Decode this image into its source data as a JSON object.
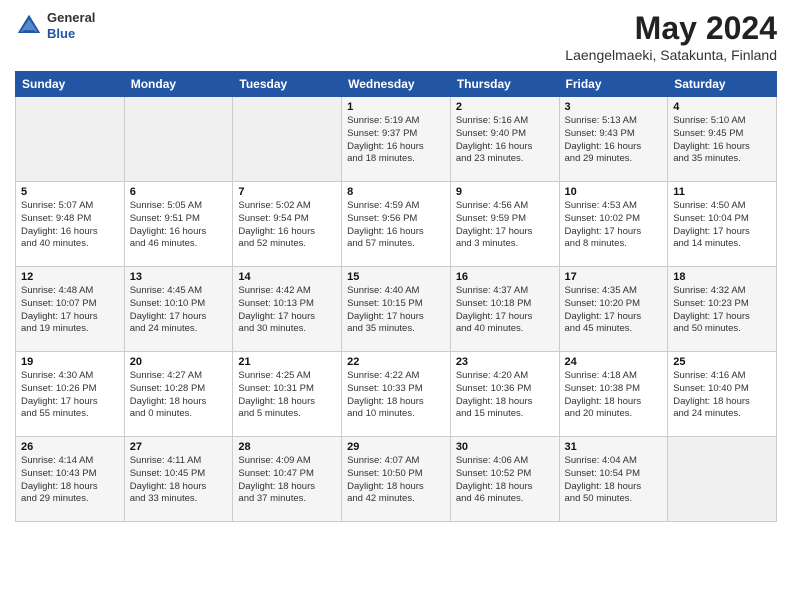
{
  "header": {
    "logo": {
      "general": "General",
      "blue": "Blue"
    },
    "title": "May 2024",
    "location": "Laengelmaeki, Satakunta, Finland"
  },
  "weekdays": [
    "Sunday",
    "Monday",
    "Tuesday",
    "Wednesday",
    "Thursday",
    "Friday",
    "Saturday"
  ],
  "weeks": [
    [
      {
        "day": "",
        "info": ""
      },
      {
        "day": "",
        "info": ""
      },
      {
        "day": "",
        "info": ""
      },
      {
        "day": "1",
        "info": "Sunrise: 5:19 AM\nSunset: 9:37 PM\nDaylight: 16 hours\nand 18 minutes."
      },
      {
        "day": "2",
        "info": "Sunrise: 5:16 AM\nSunset: 9:40 PM\nDaylight: 16 hours\nand 23 minutes."
      },
      {
        "day": "3",
        "info": "Sunrise: 5:13 AM\nSunset: 9:43 PM\nDaylight: 16 hours\nand 29 minutes."
      },
      {
        "day": "4",
        "info": "Sunrise: 5:10 AM\nSunset: 9:45 PM\nDaylight: 16 hours\nand 35 minutes."
      }
    ],
    [
      {
        "day": "5",
        "info": "Sunrise: 5:07 AM\nSunset: 9:48 PM\nDaylight: 16 hours\nand 40 minutes."
      },
      {
        "day": "6",
        "info": "Sunrise: 5:05 AM\nSunset: 9:51 PM\nDaylight: 16 hours\nand 46 minutes."
      },
      {
        "day": "7",
        "info": "Sunrise: 5:02 AM\nSunset: 9:54 PM\nDaylight: 16 hours\nand 52 minutes."
      },
      {
        "day": "8",
        "info": "Sunrise: 4:59 AM\nSunset: 9:56 PM\nDaylight: 16 hours\nand 57 minutes."
      },
      {
        "day": "9",
        "info": "Sunrise: 4:56 AM\nSunset: 9:59 PM\nDaylight: 17 hours\nand 3 minutes."
      },
      {
        "day": "10",
        "info": "Sunrise: 4:53 AM\nSunset: 10:02 PM\nDaylight: 17 hours\nand 8 minutes."
      },
      {
        "day": "11",
        "info": "Sunrise: 4:50 AM\nSunset: 10:04 PM\nDaylight: 17 hours\nand 14 minutes."
      }
    ],
    [
      {
        "day": "12",
        "info": "Sunrise: 4:48 AM\nSunset: 10:07 PM\nDaylight: 17 hours\nand 19 minutes."
      },
      {
        "day": "13",
        "info": "Sunrise: 4:45 AM\nSunset: 10:10 PM\nDaylight: 17 hours\nand 24 minutes."
      },
      {
        "day": "14",
        "info": "Sunrise: 4:42 AM\nSunset: 10:13 PM\nDaylight: 17 hours\nand 30 minutes."
      },
      {
        "day": "15",
        "info": "Sunrise: 4:40 AM\nSunset: 10:15 PM\nDaylight: 17 hours\nand 35 minutes."
      },
      {
        "day": "16",
        "info": "Sunrise: 4:37 AM\nSunset: 10:18 PM\nDaylight: 17 hours\nand 40 minutes."
      },
      {
        "day": "17",
        "info": "Sunrise: 4:35 AM\nSunset: 10:20 PM\nDaylight: 17 hours\nand 45 minutes."
      },
      {
        "day": "18",
        "info": "Sunrise: 4:32 AM\nSunset: 10:23 PM\nDaylight: 17 hours\nand 50 minutes."
      }
    ],
    [
      {
        "day": "19",
        "info": "Sunrise: 4:30 AM\nSunset: 10:26 PM\nDaylight: 17 hours\nand 55 minutes."
      },
      {
        "day": "20",
        "info": "Sunrise: 4:27 AM\nSunset: 10:28 PM\nDaylight: 18 hours\nand 0 minutes."
      },
      {
        "day": "21",
        "info": "Sunrise: 4:25 AM\nSunset: 10:31 PM\nDaylight: 18 hours\nand 5 minutes."
      },
      {
        "day": "22",
        "info": "Sunrise: 4:22 AM\nSunset: 10:33 PM\nDaylight: 18 hours\nand 10 minutes."
      },
      {
        "day": "23",
        "info": "Sunrise: 4:20 AM\nSunset: 10:36 PM\nDaylight: 18 hours\nand 15 minutes."
      },
      {
        "day": "24",
        "info": "Sunrise: 4:18 AM\nSunset: 10:38 PM\nDaylight: 18 hours\nand 20 minutes."
      },
      {
        "day": "25",
        "info": "Sunrise: 4:16 AM\nSunset: 10:40 PM\nDaylight: 18 hours\nand 24 minutes."
      }
    ],
    [
      {
        "day": "26",
        "info": "Sunrise: 4:14 AM\nSunset: 10:43 PM\nDaylight: 18 hours\nand 29 minutes."
      },
      {
        "day": "27",
        "info": "Sunrise: 4:11 AM\nSunset: 10:45 PM\nDaylight: 18 hours\nand 33 minutes."
      },
      {
        "day": "28",
        "info": "Sunrise: 4:09 AM\nSunset: 10:47 PM\nDaylight: 18 hours\nand 37 minutes."
      },
      {
        "day": "29",
        "info": "Sunrise: 4:07 AM\nSunset: 10:50 PM\nDaylight: 18 hours\nand 42 minutes."
      },
      {
        "day": "30",
        "info": "Sunrise: 4:06 AM\nSunset: 10:52 PM\nDaylight: 18 hours\nand 46 minutes."
      },
      {
        "day": "31",
        "info": "Sunrise: 4:04 AM\nSunset: 10:54 PM\nDaylight: 18 hours\nand 50 minutes."
      },
      {
        "day": "",
        "info": ""
      }
    ]
  ]
}
